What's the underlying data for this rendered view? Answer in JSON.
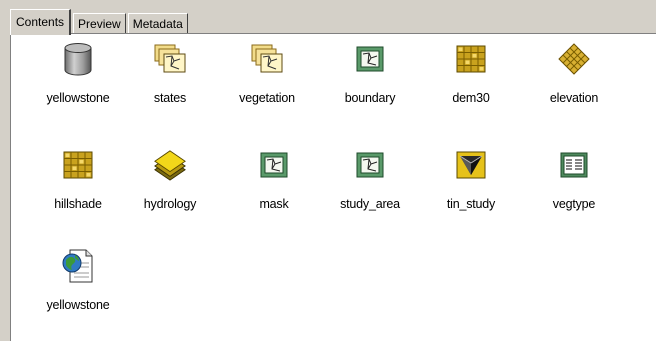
{
  "tabs": [
    {
      "label": "Contents",
      "active": true
    },
    {
      "label": "Preview",
      "active": false
    },
    {
      "label": "Metadata",
      "active": false
    }
  ],
  "items": [
    {
      "label": "yellowstone",
      "icon": "geodatabase-icon"
    },
    {
      "label": "states",
      "icon": "feature-dataset-icon"
    },
    {
      "label": "vegetation",
      "icon": "feature-dataset-icon"
    },
    {
      "label": "boundary",
      "icon": "polygon-feature-class-icon"
    },
    {
      "label": "dem30",
      "icon": "raster-dataset-icon"
    },
    {
      "label": "elevation",
      "icon": "raster-catalog-icon"
    },
    {
      "label": "hillshade",
      "icon": "raster-dataset-icon"
    },
    {
      "label": "hydrology",
      "icon": "layered-dataset-icon"
    },
    {
      "label": "mask",
      "icon": "polygon-feature-class-icon"
    },
    {
      "label": "study_area",
      "icon": "polygon-feature-class-icon"
    },
    {
      "label": "tin_study",
      "icon": "tin-icon"
    },
    {
      "label": "vegtype",
      "icon": "table-icon"
    },
    {
      "label": "yellowstone",
      "icon": "metadata-document-icon"
    }
  ]
}
